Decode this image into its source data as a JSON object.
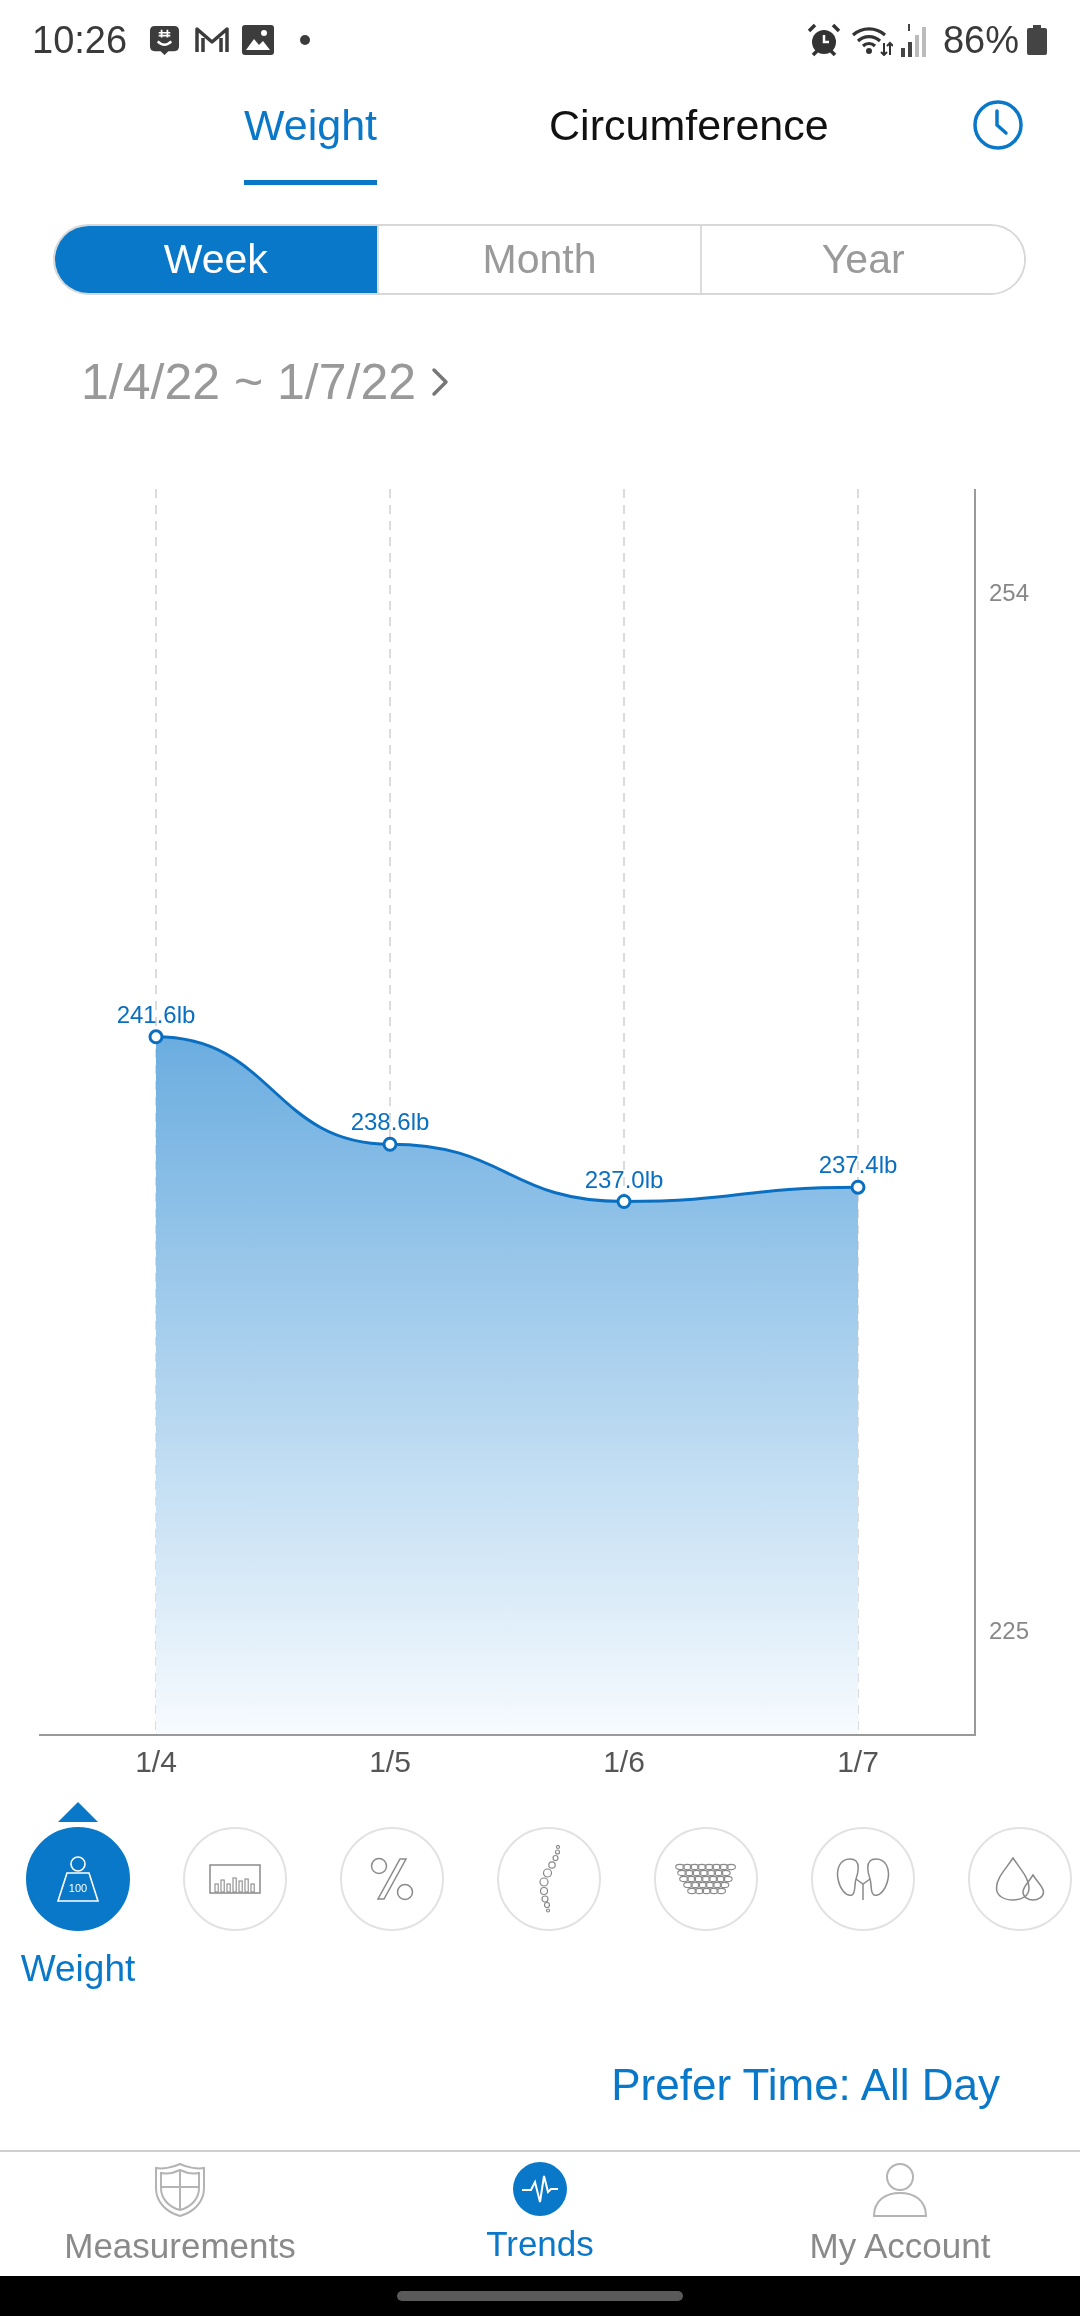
{
  "status_bar": {
    "time": "10:26",
    "battery": "86%"
  },
  "tabs": [
    {
      "label": "Weight",
      "selected": true
    },
    {
      "label": "Circumference",
      "selected": false
    }
  ],
  "periods": [
    {
      "label": "Week",
      "selected": true
    },
    {
      "label": "Month",
      "selected": false
    },
    {
      "label": "Year",
      "selected": false
    }
  ],
  "date_range": "1/4/22 ~ 1/7/22",
  "trend_chart": {
    "chart_data": {
      "type": "area",
      "categories": [
        "1/4",
        "1/5",
        "1/6",
        "1/7"
      ],
      "values": [
        241.6,
        238.6,
        237.0,
        237.4
      ],
      "ylim": [
        222.1,
        256.9
      ],
      "yticks": [
        225,
        254
      ],
      "value_labels": [
        "241.6lb",
        "238.6lb",
        "237.0lb",
        "237.4lb"
      ]
    }
  },
  "metrics": [
    {
      "kind": "weight",
      "selected": true,
      "label": "Weight",
      "icon_text": "100"
    },
    {
      "kind": "ruler",
      "selected": false
    },
    {
      "kind": "percent",
      "selected": false
    },
    {
      "kind": "bubbles",
      "selected": false
    },
    {
      "kind": "cells",
      "selected": false
    },
    {
      "kind": "kidney",
      "selected": false
    },
    {
      "kind": "drops",
      "selected": false
    }
  ],
  "prefer_time": "Prefer Time: All Day",
  "bottom_nav": [
    {
      "kind": "shield",
      "label": "Measurements",
      "selected": false
    },
    {
      "kind": "pulse",
      "label": "Trends",
      "selected": true
    },
    {
      "kind": "person",
      "label": "My Account",
      "selected": false
    }
  ]
}
